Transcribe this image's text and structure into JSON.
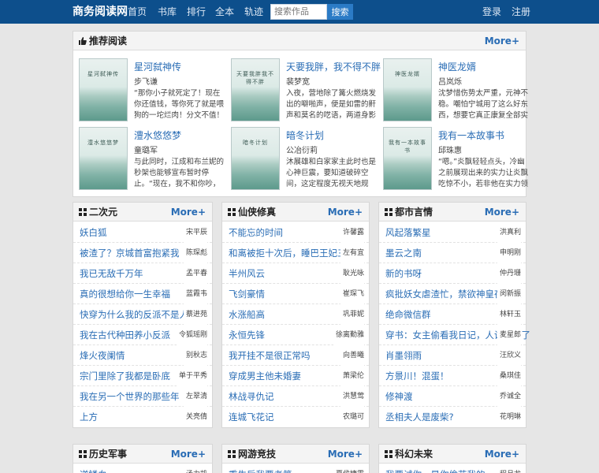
{
  "header": {
    "brand": "商务阅读网",
    "nav": [
      "首页",
      "书库",
      "排行",
      "全本",
      "轨迹"
    ],
    "search_placeholder": "搜索作品",
    "search_button": "搜索",
    "login": "登录",
    "register": "注册"
  },
  "recommend": {
    "title": "推荐阅读",
    "more": "More+",
    "books": [
      {
        "title": "星河弑神传",
        "author": "步飞谦",
        "desc": "“那你小子就死定了！现在你还值钱，等你死了就是喂狗的一坨烂肉！分文不值！你连一块",
        "cover": "星河弑神传"
      },
      {
        "title": "天要我胖，我不得不胖",
        "author": "裴梦宽",
        "desc": "入夜，营地除了篝火燃烧发出的噼啪声，便是如雷的鼾声和莫名的呓语，两道身影飘然离",
        "cover": "天要我胖我不得不胖"
      },
      {
        "title": "神医龙婿",
        "author": "吕岚烁",
        "desc": "沈梦惜伤势太严重，元神不稳。嘲怕宁城用了这么好东西，想要它真正康复全部实",
        "cover": "神医龙婿"
      },
      {
        "title": "澧水悠悠梦",
        "author": "童璐军",
        "desc": "与此同时，江成和布兰妮的秒架也能够宣布暂时停止。“现在，我不和你吵，你也不要打",
        "cover": "澧水悠悠梦"
      },
      {
        "title": "暗冬计划",
        "author": "公冶衍莉",
        "desc": "沐展雄和白家家主此时也是心神巨震，要知道破碎空间，这定程度无视天地规则，那可是",
        "cover": "暗冬计划"
      },
      {
        "title": "我有一本故事书",
        "author": "邱珠惠",
        "desc": "“嗯。”炎飘轻轻点头，冷幽之前展现出来的实力让炎飘吃惊不小，若非他在实力领先了",
        "cover": "我有一本故事书"
      }
    ]
  },
  "categories": [
    {
      "title": "二次元",
      "more": "More+",
      "items": [
        {
          "title": "妖白狐",
          "author": "宋平辰"
        },
        {
          "title": "被渣了？京城首富抱紧我",
          "author": "陈琛彪"
        },
        {
          "title": "我已无敌千万年",
          "author": "孟平春"
        },
        {
          "title": "真的很想给你一生幸福",
          "author": "蓝霞韦"
        },
        {
          "title": "快穿为什么我的反派不是人",
          "author": "蔡进苑"
        },
        {
          "title": "我在古代种田养小反派",
          "author": "令狐瑶刚"
        },
        {
          "title": "烽火夜阑情",
          "author": "别秋志"
        },
        {
          "title": "宗门里除了我都是卧底",
          "author": "单于平秀"
        },
        {
          "title": "我在另一个世界的那些年",
          "author": "左翠清"
        },
        {
          "title": "上方",
          "author": "关亮倩"
        }
      ]
    },
    {
      "title": "仙侠修真",
      "more": "More+",
      "items": [
        {
          "title": "不能忘的时间",
          "author": "许馨露"
        },
        {
          "title": "和离被拒十次后，睡巴王妃三胎了",
          "author": "左有宜"
        },
        {
          "title": "半州风云",
          "author": "耿光咏"
        },
        {
          "title": "飞剑豪情",
          "author": "崔琛飞"
        },
        {
          "title": "水涨船高",
          "author": "巩菲妮"
        },
        {
          "title": "永恒先锋",
          "author": "徐离勤雅"
        },
        {
          "title": "我开挂不是很正常吗",
          "author": "向善曦"
        },
        {
          "title": "穿成男主他未婚妻",
          "author": "萧梁伦"
        },
        {
          "title": "林战寻仇记",
          "author": "洪慧莺"
        },
        {
          "title": "连城飞花记",
          "author": "农璐可"
        }
      ]
    },
    {
      "title": "都市言情",
      "more": "More+",
      "items": [
        {
          "title": "风起落繁星",
          "author": "洪真利"
        },
        {
          "title": "墨云之南",
          "author": "申明刚"
        },
        {
          "title": "新的书呀",
          "author": "仲丹珊"
        },
        {
          "title": "疯批妖女虐渣忙，禁欲神皇夜夜追",
          "author": "闵新振"
        },
        {
          "title": "绝命微信群",
          "author": "林轩玉"
        },
        {
          "title": "穿书：女主偷看我日记，人设全崩了",
          "author": "麦星郎"
        },
        {
          "title": "肖墨翎雨",
          "author": "汪欣义"
        },
        {
          "title": "方景川！混蛋！",
          "author": "桑琪佳"
        },
        {
          "title": "修神渡",
          "author": "乔诚全"
        },
        {
          "title": "丞相夫人是废柴?",
          "author": "花明琳"
        }
      ]
    },
    {
      "title": "历史军事",
      "more": "More+",
      "items": [
        {
          "title": "逆鳞血",
          "author": "汤力凯"
        }
      ]
    },
    {
      "title": "网游竞技",
      "more": "More+",
      "items": [
        {
          "title": "重生后我要考第一",
          "author": "夏侯婕霞"
        }
      ]
    },
    {
      "title": "科幻未来",
      "more": "More+",
      "items": [
        {
          "title": "我要试你，是你偷花我的",
          "author": "程月龙"
        }
      ]
    }
  ]
}
